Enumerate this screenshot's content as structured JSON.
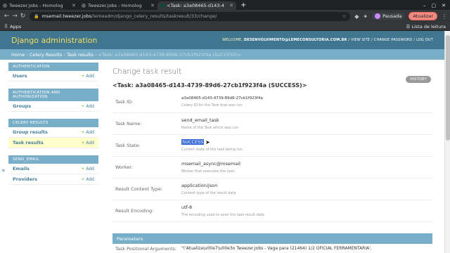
{
  "browser": {
    "tabs": [
      {
        "title": "Tweezer.jobs - Homolog"
      },
      {
        "title": "Tweezer.jobs - Homolog"
      },
      {
        "title": "<Task: a3a08465-d143-4"
      }
    ],
    "url_host": "msemail.tweezer.jobs",
    "url_path": "/lemeadm/django_celery_results/taskresult/33/change/",
    "profile_label": "Pausada",
    "update_label": "Atualizar",
    "apps_label": "Apps",
    "reading_list_label": "Lista de leitura"
  },
  "header": {
    "branding": "Django administration",
    "welcome": "WELCOME,",
    "user": "DESENVOLVIMENTO@LEMECONSULTORIA.COM.BR",
    "view_site": "VIEW SITE",
    "change_password": "CHANGE PASSWORD",
    "logout": "LOG OUT"
  },
  "breadcrumbs": {
    "home": "Home",
    "app": "Celery Results",
    "model": "Task results",
    "current": "<Task: a3a08465-d143-4739-89d6-27cb1f923f4a (SUCCESS)>"
  },
  "sidebar": {
    "add_label": "Add",
    "modules": [
      {
        "caption": "AUTHENTICATION",
        "items": [
          {
            "label": "Users"
          }
        ]
      },
      {
        "caption": "AUTHENTICATION AND AUTHORIZATION",
        "items": [
          {
            "label": "Groups"
          }
        ]
      },
      {
        "caption": "CELERY RESULTS",
        "items": [
          {
            "label": "Group results"
          },
          {
            "label": "Task results"
          }
        ]
      },
      {
        "caption": "SEND_EMAIL",
        "items": [
          {
            "label": "Emails"
          },
          {
            "label": "Providers"
          }
        ]
      }
    ],
    "collapse_glyph": "«"
  },
  "content": {
    "title": "Change task result",
    "object": "<Task: a3a08465-d143-4739-89d6-27cb1f923f4a (SUCCESS)>",
    "history": "HISTORY",
    "fields": [
      {
        "label": "Task ID:",
        "value": "a3a08465-d143-4739-89d6-27cb1f923f4a",
        "help": "Celery ID for the Task that was run"
      },
      {
        "label": "Task Name:",
        "value": "send_email_task",
        "help": "Name of the Task which was run"
      },
      {
        "label": "Task State:",
        "value": "SUCCESS",
        "help": "Current state of the task being run"
      },
      {
        "label": "Worker:",
        "value": "msemail_async@msemail",
        "help": "Worker that executes the task"
      },
      {
        "label": "Result Content Type:",
        "value": "application/json",
        "help": "Content type of the result data"
      },
      {
        "label": "Result Encoding:",
        "value": "utf-8",
        "help": "The encoding used to save the task result data"
      }
    ],
    "parameters_caption": "Parameters",
    "positional_label": "Task Positional Arguments:",
    "positional_value": "\"('Atualiza\\u00e7\\u00e3o Tweezer.Jobs - Vaga para (21464) 1/2 OFICIAL FERRAMENTARIA',"
  }
}
